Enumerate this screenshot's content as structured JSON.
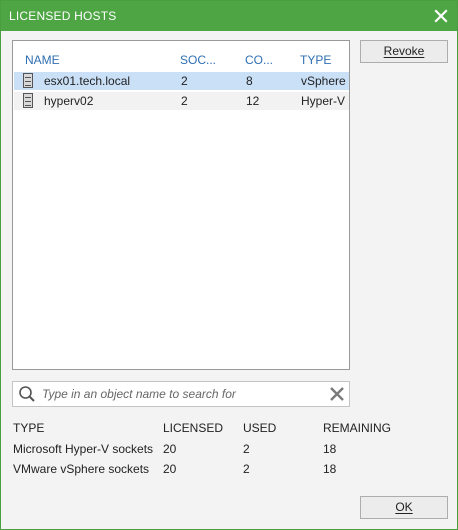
{
  "window": {
    "title": "LICENSED HOSTS"
  },
  "hosts_table": {
    "columns": [
      "NAME",
      "SOC...",
      "CO...",
      "TYPE"
    ],
    "rows": [
      {
        "name": "esx01.tech.local",
        "sockets": "2",
        "cores": "8",
        "type": "vSphere",
        "selected": true
      },
      {
        "name": "hyperv02",
        "sockets": "2",
        "cores": "12",
        "type": "Hyper-V",
        "selected": false
      }
    ]
  },
  "buttons": {
    "revoke": "Revoke",
    "ok": "OK"
  },
  "search": {
    "placeholder": "Type in an object name to search for"
  },
  "summary": {
    "headers": [
      "TYPE",
      "LICENSED",
      "USED",
      "REMAINING"
    ],
    "rows": [
      [
        "Microsoft Hyper-V sockets",
        "20",
        "2",
        "18"
      ],
      [
        "VMware vSphere sockets",
        "20",
        "2",
        "18"
      ]
    ]
  },
  "colors": {
    "title_bar": "#4ea544",
    "header_text": "#2f6fb3",
    "selection": "#c9e0f7"
  },
  "icons": [
    "close-icon",
    "server-icon",
    "search-icon",
    "clear-icon"
  ]
}
